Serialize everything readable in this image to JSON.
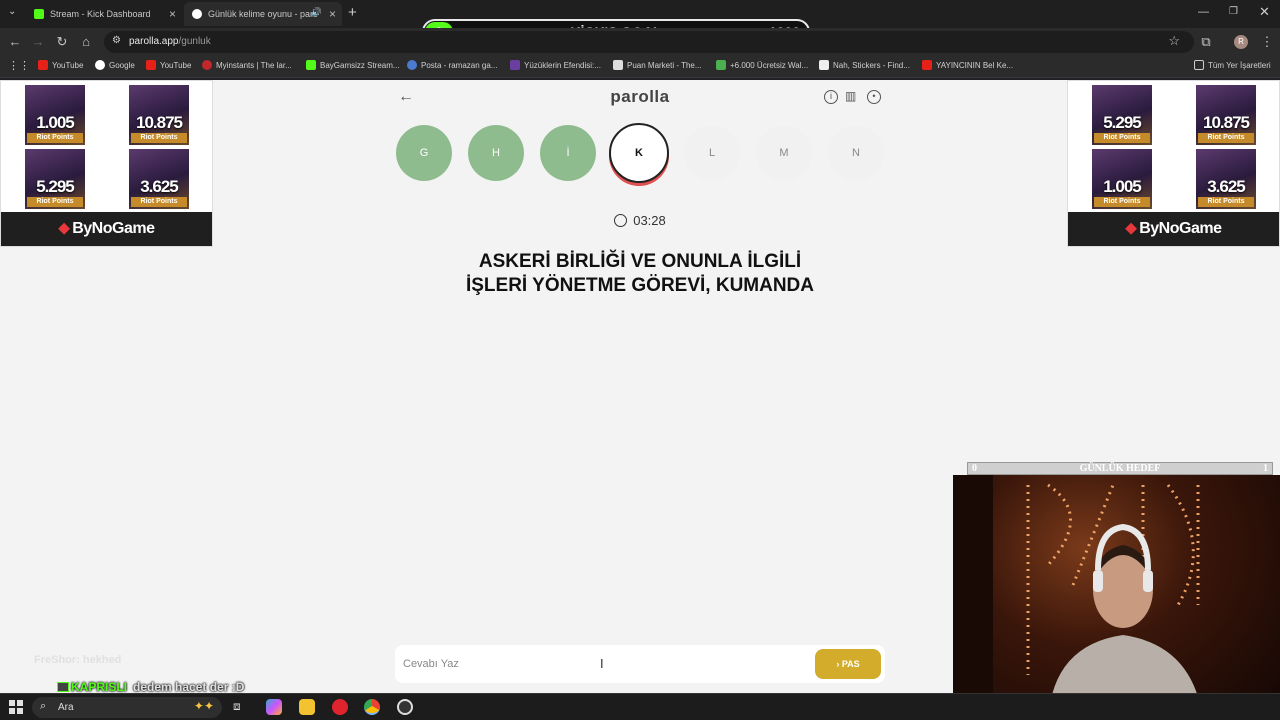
{
  "browser": {
    "tabs": [
      {
        "title": "Stream - Kick Dashboard",
        "active": false
      },
      {
        "title": "Günlük kelime oyunu - parc",
        "active": true
      }
    ],
    "new_tab_glyph": "+",
    "url_host": "parolla.app",
    "url_path": "/gunluk",
    "bookmarks": [
      "YouTube",
      "Google",
      "YouTube",
      "Myinstants | The lar...",
      "BayGamsizz Stream...",
      "Posta - ramazan ga...",
      "Yüzüklerin Efendisi:...",
      "Puan Marketi - The...",
      "+6.000 Ücretsiz Wal...",
      "Nah, Stickers - Find...",
      "YAYINCININ Bel Ke..."
    ],
    "all_bookmarks": "Tüm Yer İşaretleri",
    "profile_initial": "R"
  },
  "kick_goal": {
    "current": "1",
    "title": "KİCK'S GOAL",
    "target": "1000"
  },
  "ads": {
    "left": [
      "1.005",
      "10.875",
      "5.295",
      "3.625"
    ],
    "right": [
      "5.295",
      "10.875",
      "1.005",
      "3.625"
    ],
    "card_caption": "Riot Points",
    "brand": "ByNoGame"
  },
  "game": {
    "brand": "parolla",
    "letters": [
      {
        "char": "G",
        "state": "done"
      },
      {
        "char": "H",
        "state": "done"
      },
      {
        "char": "İ",
        "state": "done"
      },
      {
        "char": "K",
        "state": "current"
      },
      {
        "char": "L",
        "state": "pending"
      },
      {
        "char": "M",
        "state": "pending"
      },
      {
        "char": "N",
        "state": "pending"
      }
    ],
    "timer": "03:28",
    "question_line1": "ASKERİ BİRLİĞİ VE ONUNLA İLGİLİ",
    "question_line2": "İŞLERİ YÖNETME GÖREVİ, KUMANDA",
    "answer_placeholder": "Cevabı Yaz",
    "pass_label": "PAS"
  },
  "daily_goal": {
    "left": "0",
    "title": "GÜNLÜK HEDEF",
    "right": "1"
  },
  "chat": {
    "faded": "FreShor: hekhed",
    "username": "KAPRISLI",
    "message": "dedem hacet der :D"
  },
  "taskbar": {
    "search_label": "Ara"
  },
  "colors": {
    "done": "#8fbc8f",
    "pass": "#d4ac2b",
    "kick": "#53fc18"
  }
}
